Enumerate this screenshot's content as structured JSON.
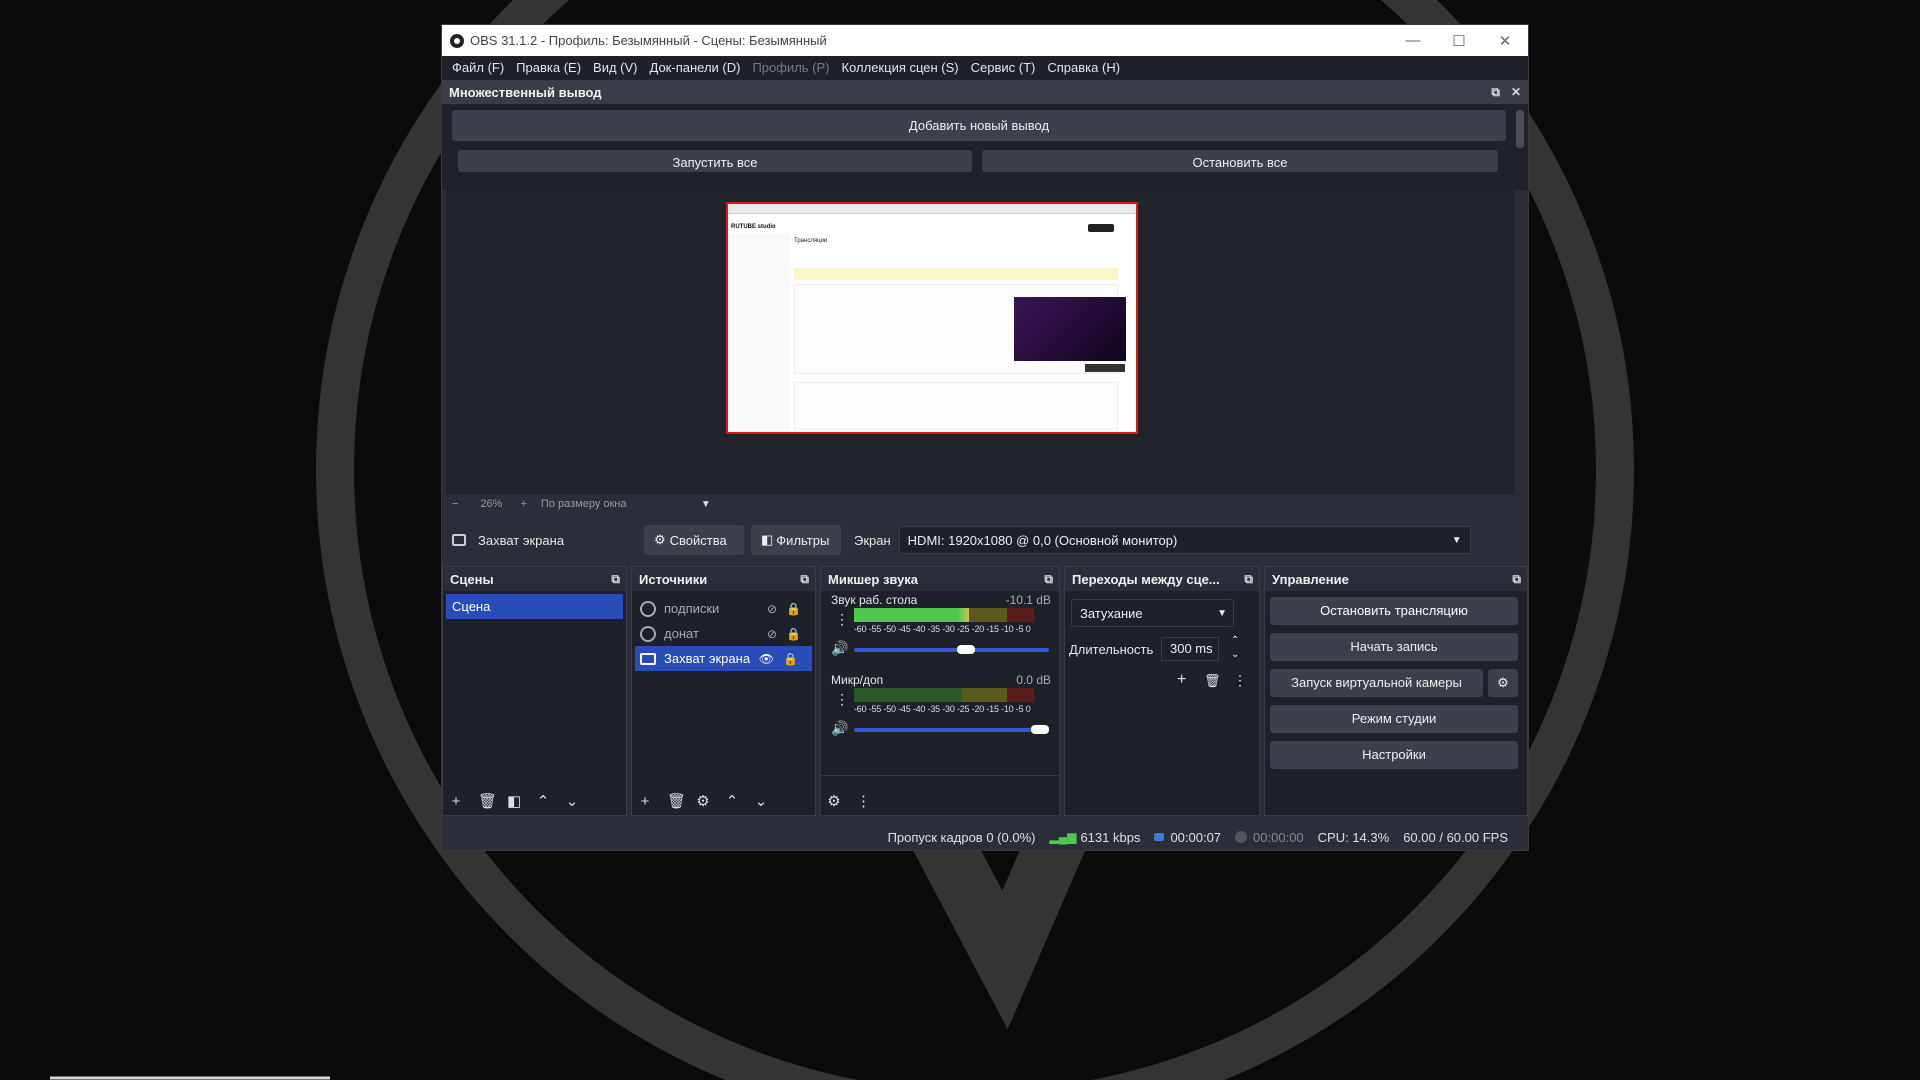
{
  "window": {
    "title": "OBS 31.1.2 - Профиль: Безымянный - Сцены: Безымянный",
    "controls": {
      "minimize": "—",
      "maximize": "☐",
      "close": "✕"
    }
  },
  "menu": [
    {
      "label": "Файл (F)",
      "disabled": false
    },
    {
      "label": "Правка (E)",
      "disabled": false
    },
    {
      "label": "Вид (V)",
      "disabled": false
    },
    {
      "label": "Док-панели (D)",
      "disabled": false
    },
    {
      "label": "Профиль (P)",
      "disabled": true
    },
    {
      "label": "Коллекция сцен (S)",
      "disabled": false
    },
    {
      "label": "Сервис (T)",
      "disabled": false
    },
    {
      "label": "Справка (H)",
      "disabled": false
    }
  ],
  "multi_output": {
    "title": "Множественный вывод",
    "add_button": "Добавить новый вывод",
    "start_all": "Запустить все",
    "stop_all": "Остановить все"
  },
  "preview": {
    "captured_page_title": "Трансляции",
    "captured_site_logo": "RUTUBE studio",
    "zoom": "26%",
    "zoom_minus": "−",
    "zoom_plus": "+",
    "fit_mode": "По размеру окна"
  },
  "source_toolbar": {
    "source_name": "Захват экрана",
    "properties": "Свойства",
    "filters": "Фильтры",
    "screen_label": "Экран",
    "screen_value": "HDMI: 1920x1080 @ 0,0 (Основной монитор)"
  },
  "scenes": {
    "title": "Сцены",
    "items": [
      {
        "label": "Сцена",
        "selected": true
      }
    ]
  },
  "sources": {
    "title": "Источники",
    "items": [
      {
        "label": "подписки",
        "visible": false,
        "locked": true,
        "selected": false
      },
      {
        "label": "донат",
        "visible": false,
        "locked": true,
        "selected": false
      },
      {
        "label": "Захват экрана",
        "visible": true,
        "locked": true,
        "selected": true
      }
    ]
  },
  "mixer": {
    "title": "Микшер звука",
    "channels": [
      {
        "name": "Звук раб. стола",
        "db": "-10.1 dB",
        "level": 0.64,
        "volume": 0.62
      },
      {
        "name": "Микр/доп",
        "db": "0.0 dB",
        "level": 0.0,
        "volume": 1.0
      }
    ],
    "ticks": "-60 -55 -50 -45 -40 -35 -30 -25 -20 -15 -10  -5  0"
  },
  "transitions": {
    "title": "Переходы между сце...",
    "selected": "Затухание",
    "duration_label": "Длительность",
    "duration_value": "300 ms"
  },
  "controls": {
    "title": "Управление",
    "stop_stream": "Остановить трансляцию",
    "start_record": "Начать запись",
    "virtual_cam": "Запуск виртуальной камеры",
    "studio_mode": "Режим студии",
    "settings": "Настройки"
  },
  "status": {
    "dropped": "Пропуск кадров 0 (0.0%)",
    "bitrate": "6131 kbps",
    "stream_time": "00:00:07",
    "record_time": "00:00:00",
    "cpu": "CPU: 14.3%",
    "fps": "60.00 / 60.00 FPS"
  },
  "colors": {
    "accent": "#284cb8",
    "meter_green": "#4ec94e",
    "selection_border": "#e0161c"
  }
}
